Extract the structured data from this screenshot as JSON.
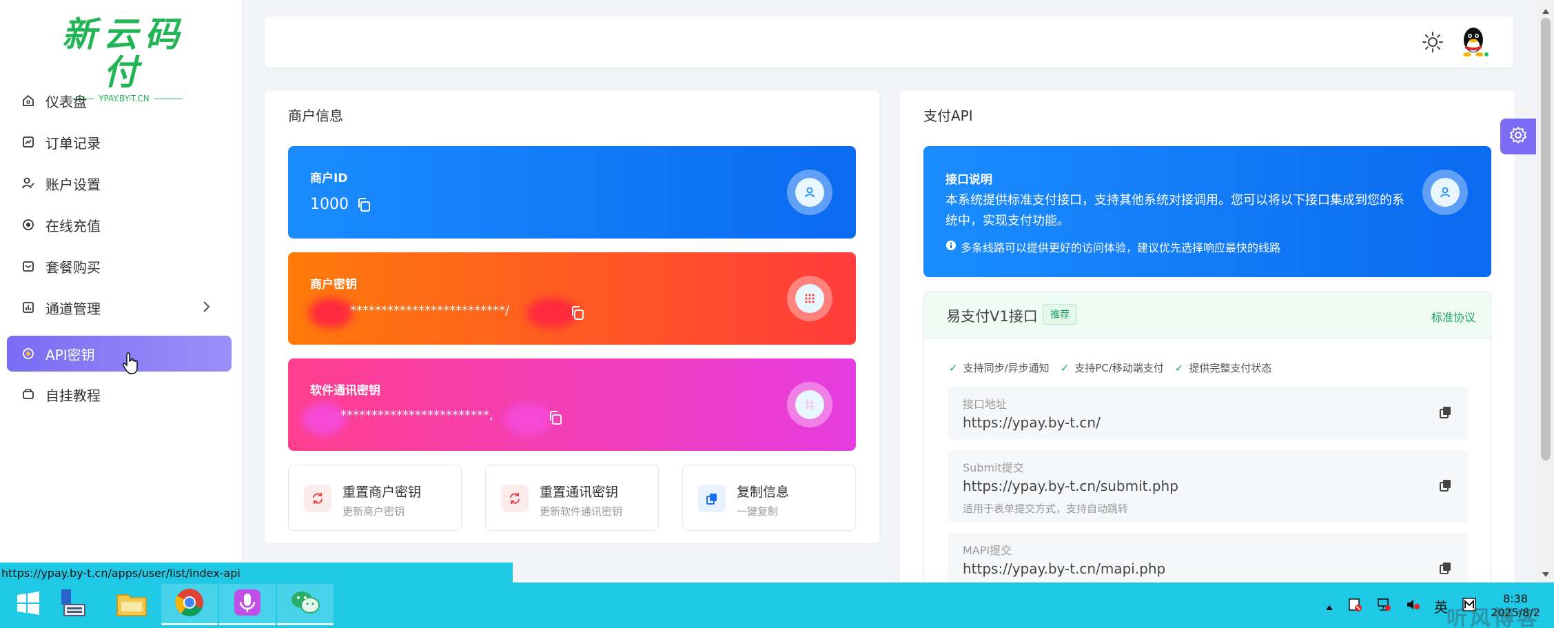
{
  "brand": {
    "logo_text": "新云码付",
    "logo_sub": "YPAY.BY-T.CN"
  },
  "sidebar": {
    "items": [
      {
        "label": "仪表盘",
        "icon": "home-icon"
      },
      {
        "label": "订单记录",
        "icon": "chart-icon"
      },
      {
        "label": "账户设置",
        "icon": "user-edit-icon"
      },
      {
        "label": "在线充值",
        "icon": "coin-icon"
      },
      {
        "label": "套餐购买",
        "icon": "bag-icon"
      },
      {
        "label": "通道管理",
        "icon": "bar-chart-icon",
        "has_submenu": true
      },
      {
        "label": "API密钥",
        "icon": "key-icon",
        "active": true
      },
      {
        "label": "自挂教程",
        "icon": "book-icon"
      }
    ]
  },
  "merchant": {
    "title": "商户信息",
    "id_label": "商户ID",
    "id_value": "1000",
    "key_label": "商户密钥",
    "key_value": "*************************/",
    "comm_label": "软件通讯密钥",
    "comm_value": "************************,",
    "actions": [
      {
        "title": "重置商户密钥",
        "sub": "更新商户密钥"
      },
      {
        "title": "重置通讯密钥",
        "sub": "更新软件通讯密钥"
      },
      {
        "title": "复制信息",
        "sub": "一键复制"
      }
    ]
  },
  "api": {
    "title": "支付API",
    "info_title": "接口说明",
    "info_desc": "本系统提供标准支付接口，支持其他系统对接调用。您可以将以下接口集成到您的系统中，实现支付功能。",
    "info_tip": "多条线路可以提供更好的访问体验，建议优先选择响应最快的线路",
    "box_title": "易支付V1接口",
    "badge": "推荐",
    "protocol": "标准协议",
    "features": [
      "支持同步/异步通知",
      "支持PC/移动端支付",
      "提供完整支付状态"
    ],
    "fields": [
      {
        "label": "接口地址",
        "value": "https://ypay.by-t.cn/",
        "note": ""
      },
      {
        "label": "Submit提交",
        "value": "https://ypay.by-t.cn/submit.php",
        "note": "适用于表单提交方式，支持自动跳转"
      },
      {
        "label": "MAPI提交",
        "value": "https://ypay.by-t.cn/mapi.php",
        "note": ""
      }
    ]
  },
  "status_url": "https://ypay.by-t.cn/apps/user/list/index-api",
  "taskbar": {
    "time": "8:38",
    "date": "2025/8/2",
    "ime": "英",
    "watermark": "听风博客"
  },
  "colors": {
    "accent": "#7a6cf3",
    "blue": "#1a8cff",
    "orange": "#ff6a1a",
    "pink": "#f23eb8",
    "green": "#1aa260",
    "taskbar": "#1fc8e4"
  }
}
